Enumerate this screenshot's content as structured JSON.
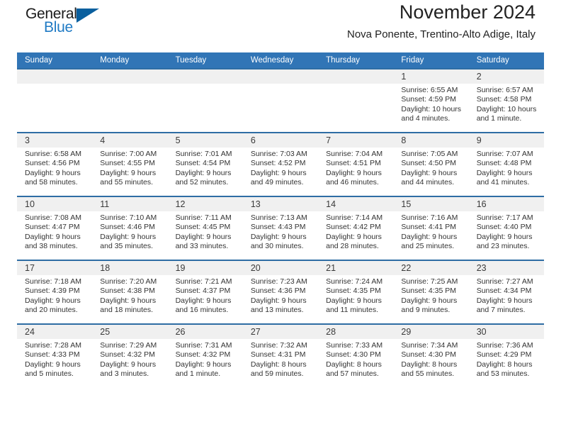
{
  "brand": {
    "name_part1": "General",
    "name_part2": "Blue",
    "triangle_color": "#0a5f9e",
    "blue_color": "#1f7ac4"
  },
  "header": {
    "title": "November 2024",
    "location": "Nova Ponente, Trentino-Alto Adige, Italy"
  },
  "theme": {
    "header_blue": "#3175b6",
    "separator_blue": "#2e6da4",
    "date_band_gray": "#f0f0f0"
  },
  "weekdays": [
    "Sunday",
    "Monday",
    "Tuesday",
    "Wednesday",
    "Thursday",
    "Friday",
    "Saturday"
  ],
  "weeks": [
    [
      {
        "day": "",
        "sunrise": "",
        "sunset": "",
        "daylight1": "",
        "daylight2": ""
      },
      {
        "day": "",
        "sunrise": "",
        "sunset": "",
        "daylight1": "",
        "daylight2": ""
      },
      {
        "day": "",
        "sunrise": "",
        "sunset": "",
        "daylight1": "",
        "daylight2": ""
      },
      {
        "day": "",
        "sunrise": "",
        "sunset": "",
        "daylight1": "",
        "daylight2": ""
      },
      {
        "day": "",
        "sunrise": "",
        "sunset": "",
        "daylight1": "",
        "daylight2": ""
      },
      {
        "day": "1",
        "sunrise": "Sunrise: 6:55 AM",
        "sunset": "Sunset: 4:59 PM",
        "daylight1": "Daylight: 10 hours",
        "daylight2": "and 4 minutes."
      },
      {
        "day": "2",
        "sunrise": "Sunrise: 6:57 AM",
        "sunset": "Sunset: 4:58 PM",
        "daylight1": "Daylight: 10 hours",
        "daylight2": "and 1 minute."
      }
    ],
    [
      {
        "day": "3",
        "sunrise": "Sunrise: 6:58 AM",
        "sunset": "Sunset: 4:56 PM",
        "daylight1": "Daylight: 9 hours",
        "daylight2": "and 58 minutes."
      },
      {
        "day": "4",
        "sunrise": "Sunrise: 7:00 AM",
        "sunset": "Sunset: 4:55 PM",
        "daylight1": "Daylight: 9 hours",
        "daylight2": "and 55 minutes."
      },
      {
        "day": "5",
        "sunrise": "Sunrise: 7:01 AM",
        "sunset": "Sunset: 4:54 PM",
        "daylight1": "Daylight: 9 hours",
        "daylight2": "and 52 minutes."
      },
      {
        "day": "6",
        "sunrise": "Sunrise: 7:03 AM",
        "sunset": "Sunset: 4:52 PM",
        "daylight1": "Daylight: 9 hours",
        "daylight2": "and 49 minutes."
      },
      {
        "day": "7",
        "sunrise": "Sunrise: 7:04 AM",
        "sunset": "Sunset: 4:51 PM",
        "daylight1": "Daylight: 9 hours",
        "daylight2": "and 46 minutes."
      },
      {
        "day": "8",
        "sunrise": "Sunrise: 7:05 AM",
        "sunset": "Sunset: 4:50 PM",
        "daylight1": "Daylight: 9 hours",
        "daylight2": "and 44 minutes."
      },
      {
        "day": "9",
        "sunrise": "Sunrise: 7:07 AM",
        "sunset": "Sunset: 4:48 PM",
        "daylight1": "Daylight: 9 hours",
        "daylight2": "and 41 minutes."
      }
    ],
    [
      {
        "day": "10",
        "sunrise": "Sunrise: 7:08 AM",
        "sunset": "Sunset: 4:47 PM",
        "daylight1": "Daylight: 9 hours",
        "daylight2": "and 38 minutes."
      },
      {
        "day": "11",
        "sunrise": "Sunrise: 7:10 AM",
        "sunset": "Sunset: 4:46 PM",
        "daylight1": "Daylight: 9 hours",
        "daylight2": "and 35 minutes."
      },
      {
        "day": "12",
        "sunrise": "Sunrise: 7:11 AM",
        "sunset": "Sunset: 4:45 PM",
        "daylight1": "Daylight: 9 hours",
        "daylight2": "and 33 minutes."
      },
      {
        "day": "13",
        "sunrise": "Sunrise: 7:13 AM",
        "sunset": "Sunset: 4:43 PM",
        "daylight1": "Daylight: 9 hours",
        "daylight2": "and 30 minutes."
      },
      {
        "day": "14",
        "sunrise": "Sunrise: 7:14 AM",
        "sunset": "Sunset: 4:42 PM",
        "daylight1": "Daylight: 9 hours",
        "daylight2": "and 28 minutes."
      },
      {
        "day": "15",
        "sunrise": "Sunrise: 7:16 AM",
        "sunset": "Sunset: 4:41 PM",
        "daylight1": "Daylight: 9 hours",
        "daylight2": "and 25 minutes."
      },
      {
        "day": "16",
        "sunrise": "Sunrise: 7:17 AM",
        "sunset": "Sunset: 4:40 PM",
        "daylight1": "Daylight: 9 hours",
        "daylight2": "and 23 minutes."
      }
    ],
    [
      {
        "day": "17",
        "sunrise": "Sunrise: 7:18 AM",
        "sunset": "Sunset: 4:39 PM",
        "daylight1": "Daylight: 9 hours",
        "daylight2": "and 20 minutes."
      },
      {
        "day": "18",
        "sunrise": "Sunrise: 7:20 AM",
        "sunset": "Sunset: 4:38 PM",
        "daylight1": "Daylight: 9 hours",
        "daylight2": "and 18 minutes."
      },
      {
        "day": "19",
        "sunrise": "Sunrise: 7:21 AM",
        "sunset": "Sunset: 4:37 PM",
        "daylight1": "Daylight: 9 hours",
        "daylight2": "and 16 minutes."
      },
      {
        "day": "20",
        "sunrise": "Sunrise: 7:23 AM",
        "sunset": "Sunset: 4:36 PM",
        "daylight1": "Daylight: 9 hours",
        "daylight2": "and 13 minutes."
      },
      {
        "day": "21",
        "sunrise": "Sunrise: 7:24 AM",
        "sunset": "Sunset: 4:35 PM",
        "daylight1": "Daylight: 9 hours",
        "daylight2": "and 11 minutes."
      },
      {
        "day": "22",
        "sunrise": "Sunrise: 7:25 AM",
        "sunset": "Sunset: 4:35 PM",
        "daylight1": "Daylight: 9 hours",
        "daylight2": "and 9 minutes."
      },
      {
        "day": "23",
        "sunrise": "Sunrise: 7:27 AM",
        "sunset": "Sunset: 4:34 PM",
        "daylight1": "Daylight: 9 hours",
        "daylight2": "and 7 minutes."
      }
    ],
    [
      {
        "day": "24",
        "sunrise": "Sunrise: 7:28 AM",
        "sunset": "Sunset: 4:33 PM",
        "daylight1": "Daylight: 9 hours",
        "daylight2": "and 5 minutes."
      },
      {
        "day": "25",
        "sunrise": "Sunrise: 7:29 AM",
        "sunset": "Sunset: 4:32 PM",
        "daylight1": "Daylight: 9 hours",
        "daylight2": "and 3 minutes."
      },
      {
        "day": "26",
        "sunrise": "Sunrise: 7:31 AM",
        "sunset": "Sunset: 4:32 PM",
        "daylight1": "Daylight: 9 hours",
        "daylight2": "and 1 minute."
      },
      {
        "day": "27",
        "sunrise": "Sunrise: 7:32 AM",
        "sunset": "Sunset: 4:31 PM",
        "daylight1": "Daylight: 8 hours",
        "daylight2": "and 59 minutes."
      },
      {
        "day": "28",
        "sunrise": "Sunrise: 7:33 AM",
        "sunset": "Sunset: 4:30 PM",
        "daylight1": "Daylight: 8 hours",
        "daylight2": "and 57 minutes."
      },
      {
        "day": "29",
        "sunrise": "Sunrise: 7:34 AM",
        "sunset": "Sunset: 4:30 PM",
        "daylight1": "Daylight: 8 hours",
        "daylight2": "and 55 minutes."
      },
      {
        "day": "30",
        "sunrise": "Sunrise: 7:36 AM",
        "sunset": "Sunset: 4:29 PM",
        "daylight1": "Daylight: 8 hours",
        "daylight2": "and 53 minutes."
      }
    ]
  ]
}
